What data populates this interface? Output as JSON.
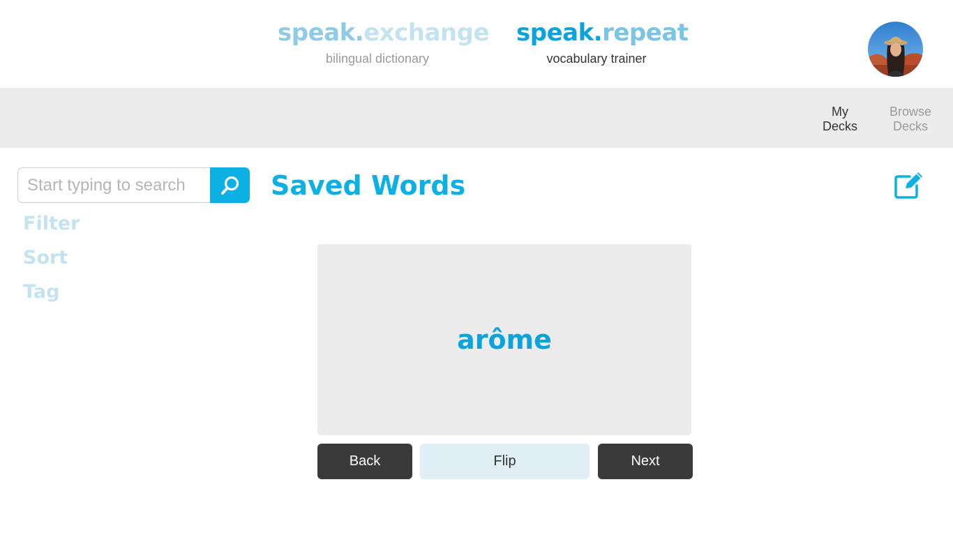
{
  "header": {
    "exchange": {
      "title_part1": "speak.",
      "title_part2": "exchange",
      "subtitle": "bilingual dictionary"
    },
    "repeat": {
      "title_part1": "speak.",
      "title_part2": "repeat",
      "subtitle": "vocabulary trainer"
    }
  },
  "nav": {
    "my_decks": {
      "line1": "My",
      "line2": "Decks"
    },
    "browse_decks": {
      "line1": "Browse",
      "line2": "Decks"
    }
  },
  "search": {
    "placeholder": "Start typing to search",
    "value": ""
  },
  "sidebar": {
    "items": [
      {
        "label": "Filter"
      },
      {
        "label": "Sort"
      },
      {
        "label": "Tag"
      }
    ]
  },
  "main": {
    "title": "Saved Words",
    "card_word": "arôme"
  },
  "controls": {
    "back": "Back",
    "flip": "Flip",
    "next": "Next"
  },
  "colors": {
    "accent": "#0db0e3",
    "accent_light": "#c4e3f1",
    "dark_button": "#3a3a3a",
    "flip_button": "#e0eef6",
    "nav_bg": "#ececec"
  },
  "icons": {
    "search": "search-icon",
    "edit": "edit-icon",
    "avatar": "avatar"
  }
}
